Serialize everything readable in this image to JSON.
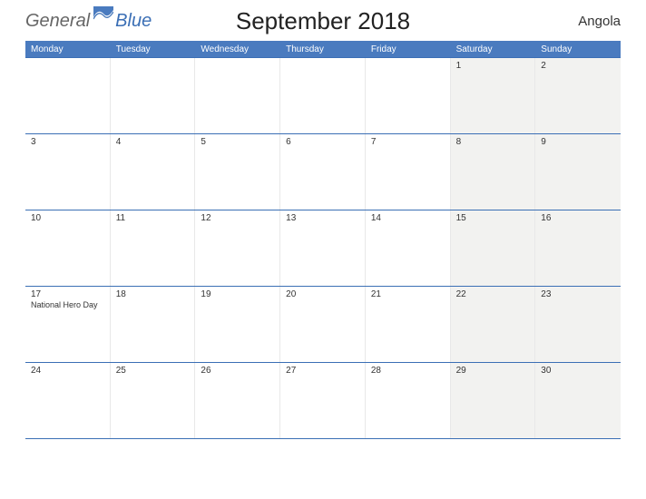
{
  "logo": {
    "part1": "General",
    "part2": "Blue"
  },
  "title": "September 2018",
  "region": "Angola",
  "weekdays": [
    "Monday",
    "Tuesday",
    "Wednesday",
    "Thursday",
    "Friday",
    "Saturday",
    "Sunday"
  ],
  "weeks": [
    [
      {
        "num": "",
        "event": "",
        "weekend": false
      },
      {
        "num": "",
        "event": "",
        "weekend": false
      },
      {
        "num": "",
        "event": "",
        "weekend": false
      },
      {
        "num": "",
        "event": "",
        "weekend": false
      },
      {
        "num": "",
        "event": "",
        "weekend": false
      },
      {
        "num": "1",
        "event": "",
        "weekend": true
      },
      {
        "num": "2",
        "event": "",
        "weekend": true
      }
    ],
    [
      {
        "num": "3",
        "event": "",
        "weekend": false
      },
      {
        "num": "4",
        "event": "",
        "weekend": false
      },
      {
        "num": "5",
        "event": "",
        "weekend": false
      },
      {
        "num": "6",
        "event": "",
        "weekend": false
      },
      {
        "num": "7",
        "event": "",
        "weekend": false
      },
      {
        "num": "8",
        "event": "",
        "weekend": true
      },
      {
        "num": "9",
        "event": "",
        "weekend": true
      }
    ],
    [
      {
        "num": "10",
        "event": "",
        "weekend": false
      },
      {
        "num": "11",
        "event": "",
        "weekend": false
      },
      {
        "num": "12",
        "event": "",
        "weekend": false
      },
      {
        "num": "13",
        "event": "",
        "weekend": false
      },
      {
        "num": "14",
        "event": "",
        "weekend": false
      },
      {
        "num": "15",
        "event": "",
        "weekend": true
      },
      {
        "num": "16",
        "event": "",
        "weekend": true
      }
    ],
    [
      {
        "num": "17",
        "event": "National Hero Day",
        "weekend": false
      },
      {
        "num": "18",
        "event": "",
        "weekend": false
      },
      {
        "num": "19",
        "event": "",
        "weekend": false
      },
      {
        "num": "20",
        "event": "",
        "weekend": false
      },
      {
        "num": "21",
        "event": "",
        "weekend": false
      },
      {
        "num": "22",
        "event": "",
        "weekend": true
      },
      {
        "num": "23",
        "event": "",
        "weekend": true
      }
    ],
    [
      {
        "num": "24",
        "event": "",
        "weekend": false
      },
      {
        "num": "25",
        "event": "",
        "weekend": false
      },
      {
        "num": "26",
        "event": "",
        "weekend": false
      },
      {
        "num": "27",
        "event": "",
        "weekend": false
      },
      {
        "num": "28",
        "event": "",
        "weekend": false
      },
      {
        "num": "29",
        "event": "",
        "weekend": true
      },
      {
        "num": "30",
        "event": "",
        "weekend": true
      }
    ]
  ]
}
